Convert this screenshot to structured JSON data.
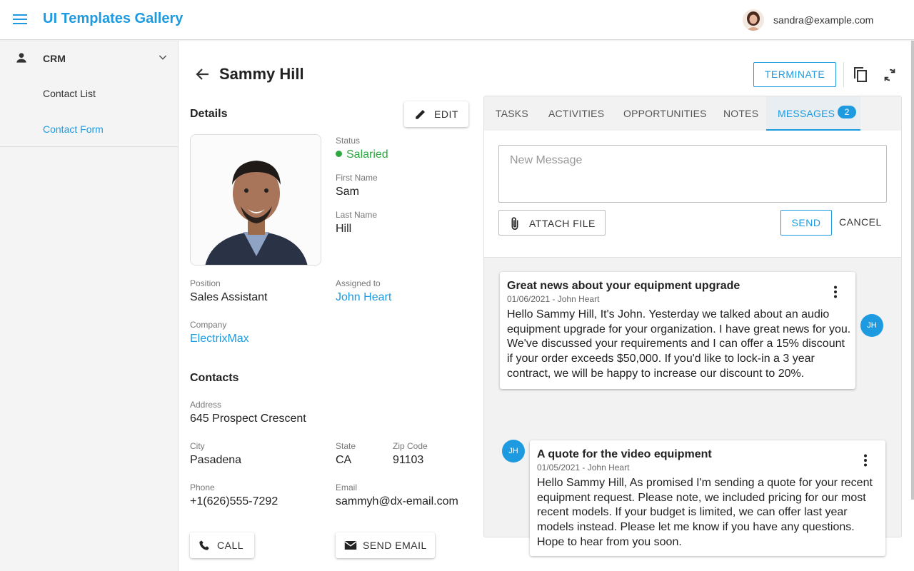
{
  "app": {
    "title": "UI Templates Gallery",
    "user_email": "sandra@example.com"
  },
  "sidebar": {
    "group_label": "CRM",
    "items": [
      {
        "label": "Contact List",
        "active": false
      },
      {
        "label": "Contact Form",
        "active": true
      }
    ]
  },
  "header": {
    "title": "Sammy Hill",
    "terminate_label": "TERMINATE"
  },
  "details": {
    "heading": "Details",
    "edit_label": "EDIT",
    "status_label": "Status",
    "status_value": "Salaried",
    "first_name_label": "First Name",
    "first_name_value": "Sam",
    "last_name_label": "Last Name",
    "last_name_value": "Hill",
    "position_label": "Position",
    "position_value": "Sales Assistant",
    "assigned_label": "Assigned to",
    "assigned_value": "John Heart",
    "company_label": "Company",
    "company_value": "ElectrixMax"
  },
  "contacts": {
    "heading": "Contacts",
    "address_label": "Address",
    "address_value": "645 Prospect Crescent",
    "city_label": "City",
    "city_value": "Pasadena",
    "state_label": "State",
    "state_value": "CA",
    "zip_label": "Zip Code",
    "zip_value": "91103",
    "phone_label": "Phone",
    "phone_value": "+1(626)555-7292",
    "email_label": "Email",
    "email_value": "sammyh@dx-email.com",
    "call_label": "CALL",
    "send_email_label": "SEND EMAIL"
  },
  "tabs": {
    "tasks": "TASKS",
    "activities": "ACTIVITIES",
    "opportunities": "OPPORTUNITIES",
    "notes": "NOTES",
    "messages": "MESSAGES",
    "messages_count": "2"
  },
  "compose": {
    "placeholder": "New Message",
    "attach_label": "ATTACH FILE",
    "send_label": "SEND",
    "cancel_label": "CANCEL"
  },
  "messages": [
    {
      "subject": "Great news about your equipment upgrade",
      "meta": "01/06/2021 - John Heart",
      "initials": "JH",
      "body": "Hello Sammy Hill, It's John. Yesterday we talked about an audio equipment upgrade for your organization. I have great news for you. We've discussed your requirements and I can offer a 15% discount if your order exceeds $50,000. If you'd like to lock-in a 3 year contract, we will be happy to increase our discount to 20%."
    },
    {
      "subject": "A quote for the video equipment",
      "meta": "01/05/2021 - John Heart",
      "initials": "JH",
      "body": "Hello Sammy Hill, As promised I'm sending a quote for your recent equipment request. Please note, we included pricing for our most recent models. If your budget is limited, we can offer last year models instead. Please let me know if you have any questions. Hope to hear from you soon."
    }
  ],
  "colors": {
    "accent": "#1e9be0",
    "status_green": "#2ea740"
  }
}
